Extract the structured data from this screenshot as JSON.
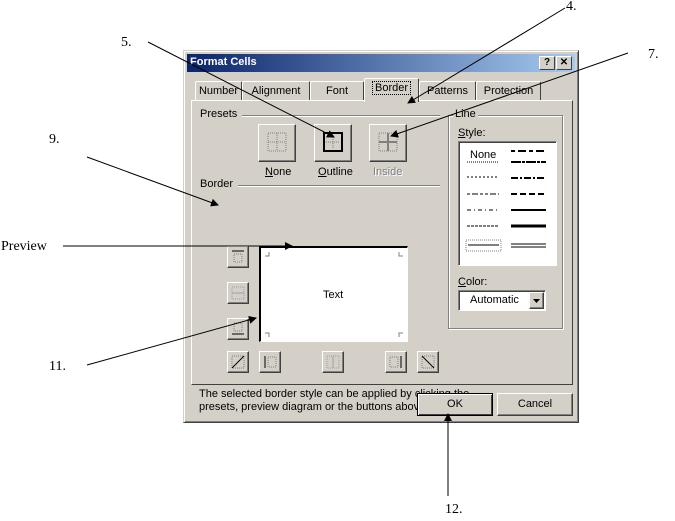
{
  "dialog": {
    "title": "Format Cells",
    "help_button": "?",
    "close_button": "✕"
  },
  "tabs": [
    {
      "label": "Number",
      "active": false
    },
    {
      "label": "Alignment",
      "active": false
    },
    {
      "label": "Font",
      "active": false
    },
    {
      "label": "Border",
      "active": true
    },
    {
      "label": "Patterns",
      "active": false
    },
    {
      "label": "Protection",
      "active": false
    }
  ],
  "presets": {
    "group_label": "Presets",
    "items": [
      {
        "label": "None",
        "accel": "N",
        "rest": "one",
        "icon": "preset-none-icon",
        "enabled": true
      },
      {
        "label": "Outline",
        "accel": "O",
        "rest": "utline",
        "icon": "preset-outline-icon",
        "enabled": true
      },
      {
        "label": "Inside",
        "accel": "",
        "rest": "Inside",
        "icon": "preset-inside-icon",
        "enabled": false
      }
    ]
  },
  "border": {
    "group_label": "Border",
    "preview_text": "Text",
    "buttons": [
      "top-border",
      "inside-horizontal-border",
      "bottom-border",
      "diagonal-up-border",
      "left-border",
      "inside-vertical-border",
      "right-border",
      "diagonal-down-border"
    ]
  },
  "line": {
    "group_label": "Line",
    "style_label_accel": "S",
    "style_label_rest": "tyle:",
    "style_none": "None",
    "color_label_accel": "C",
    "color_label_rest": "olor:",
    "color_value": "Automatic"
  },
  "hint": "The selected border style can be applied by clicking the presets, preview diagram or the buttons above.",
  "buttons": {
    "ok": "OK",
    "cancel": "Cancel"
  },
  "annotations": {
    "a4": "4.",
    "a5": "5.",
    "a7": "7.",
    "a9": "9.",
    "preview": "Preview",
    "a11": "11.",
    "a12": "12."
  }
}
